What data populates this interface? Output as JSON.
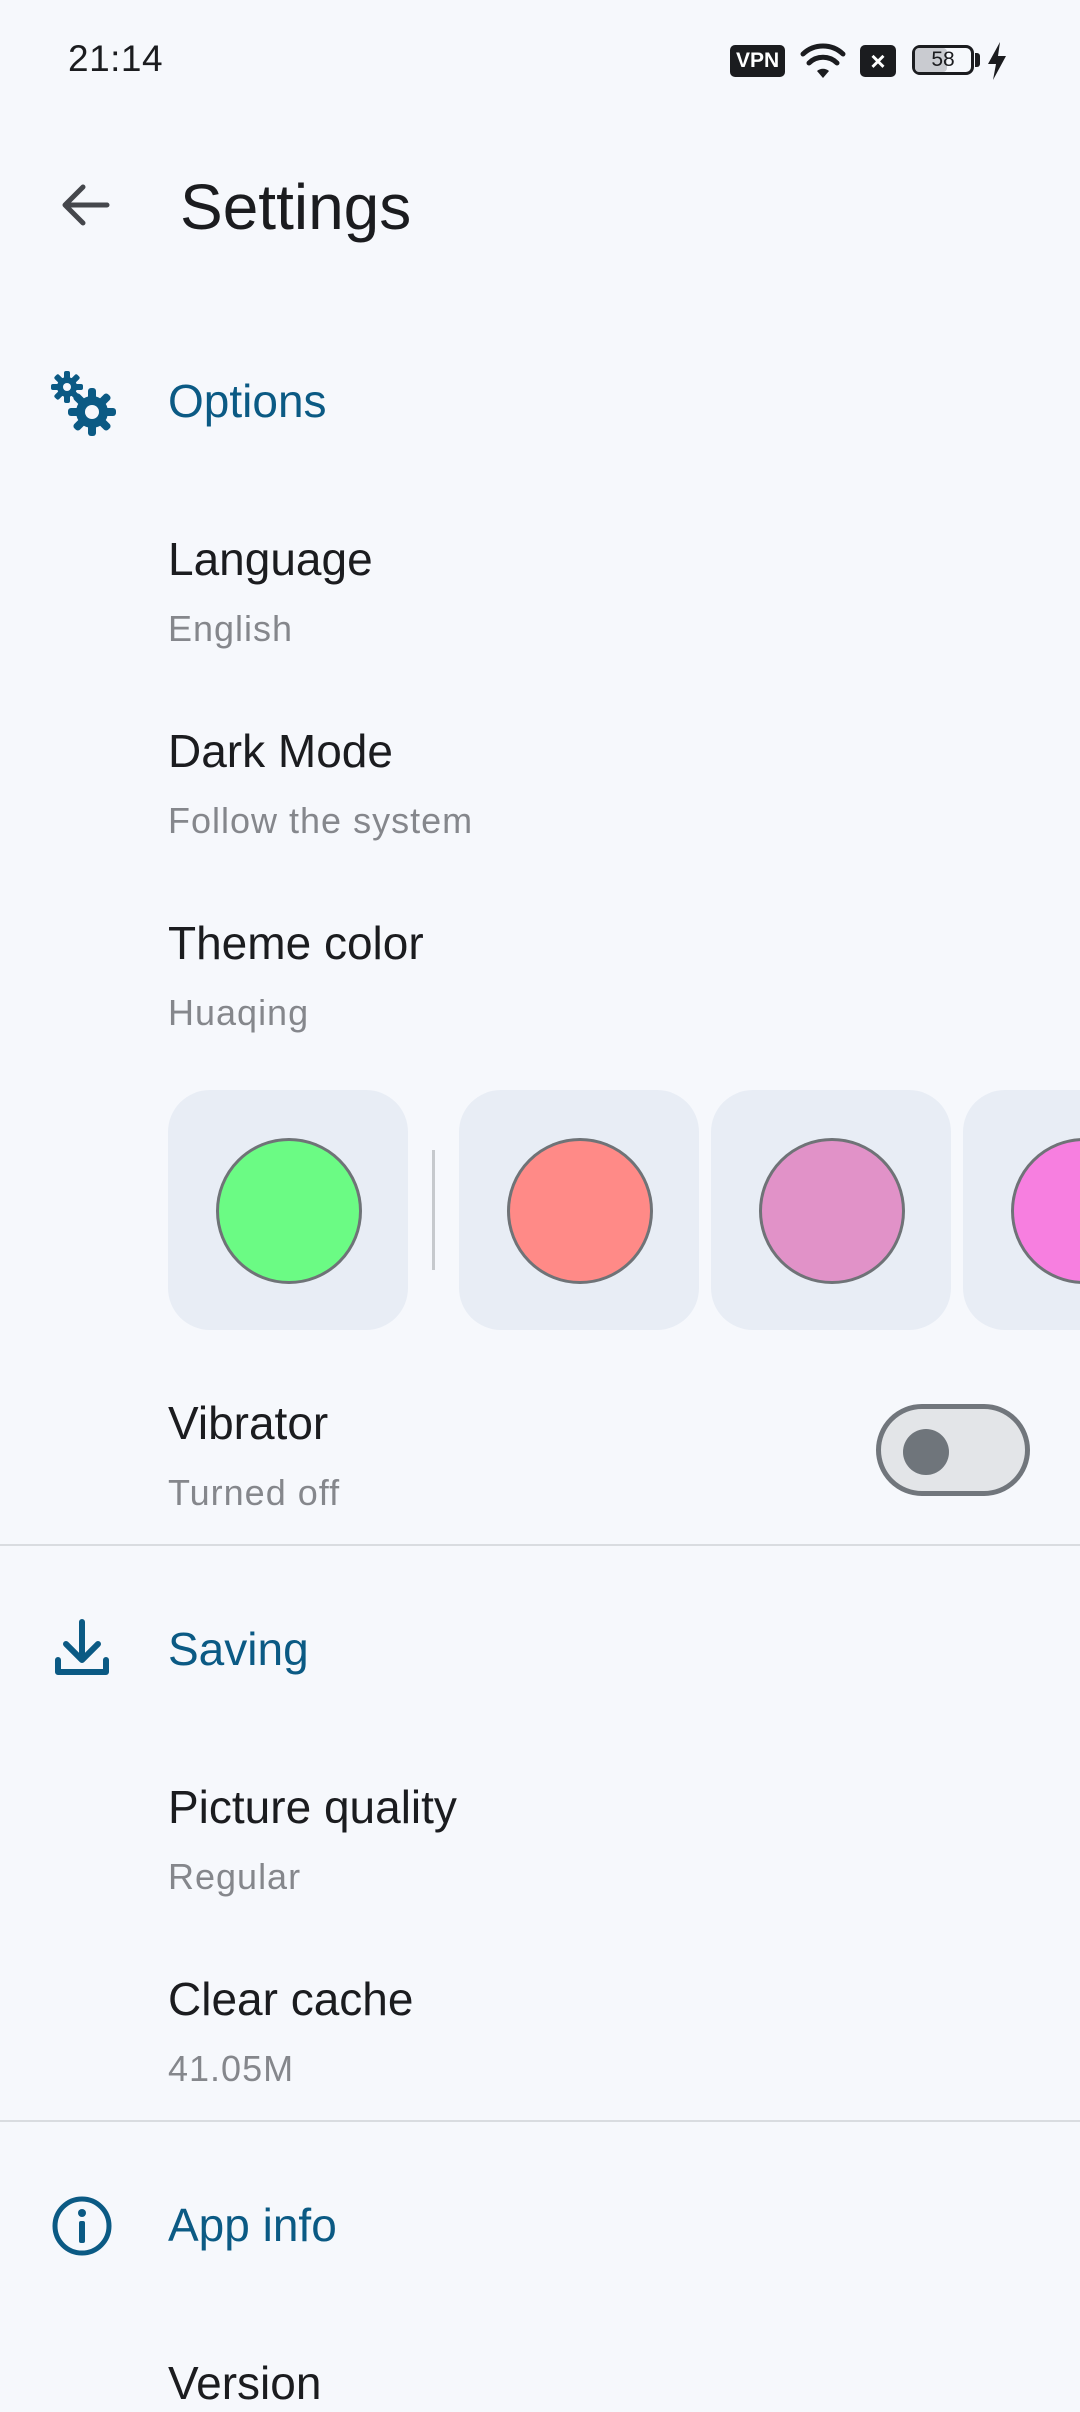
{
  "status_bar": {
    "time": "21:14",
    "vpn_label": "VPN",
    "battery_text": "58",
    "battery_level": 0.58,
    "icons": [
      "vpn-icon",
      "wifi-icon",
      "notification-blocked-icon",
      "battery-icon",
      "charging-bolt-icon"
    ]
  },
  "app_bar": {
    "title": "Settings",
    "back_icon": "arrow-back-icon"
  },
  "sections": {
    "options": {
      "title": "Options",
      "icon": "gears-icon",
      "items": {
        "language": {
          "title": "Language",
          "value": "English"
        },
        "dark_mode": {
          "title": "Dark Mode",
          "value": "Follow the system"
        },
        "theme_color": {
          "title": "Theme color",
          "value": "Huaqing",
          "swatches": [
            "#6bfb84",
            "#ff8a87",
            "#e192c8",
            "#f77fe0"
          ]
        },
        "vibrator": {
          "title": "Vibrator",
          "value": "Turned off",
          "enabled": false
        }
      }
    },
    "saving": {
      "title": "Saving",
      "icon": "download-icon",
      "items": {
        "picture_quality": {
          "title": "Picture quality",
          "value": "Regular"
        },
        "clear_cache": {
          "title": "Clear cache",
          "value": "41.05M"
        }
      }
    },
    "app_info": {
      "title": "App info",
      "icon": "info-icon",
      "items": {
        "version": {
          "title": "Version"
        }
      }
    }
  },
  "colors": {
    "accent": "#0b5a84",
    "background": "#f6f8fc",
    "card": "#e8edf5",
    "secondary_text": "#85878c"
  }
}
